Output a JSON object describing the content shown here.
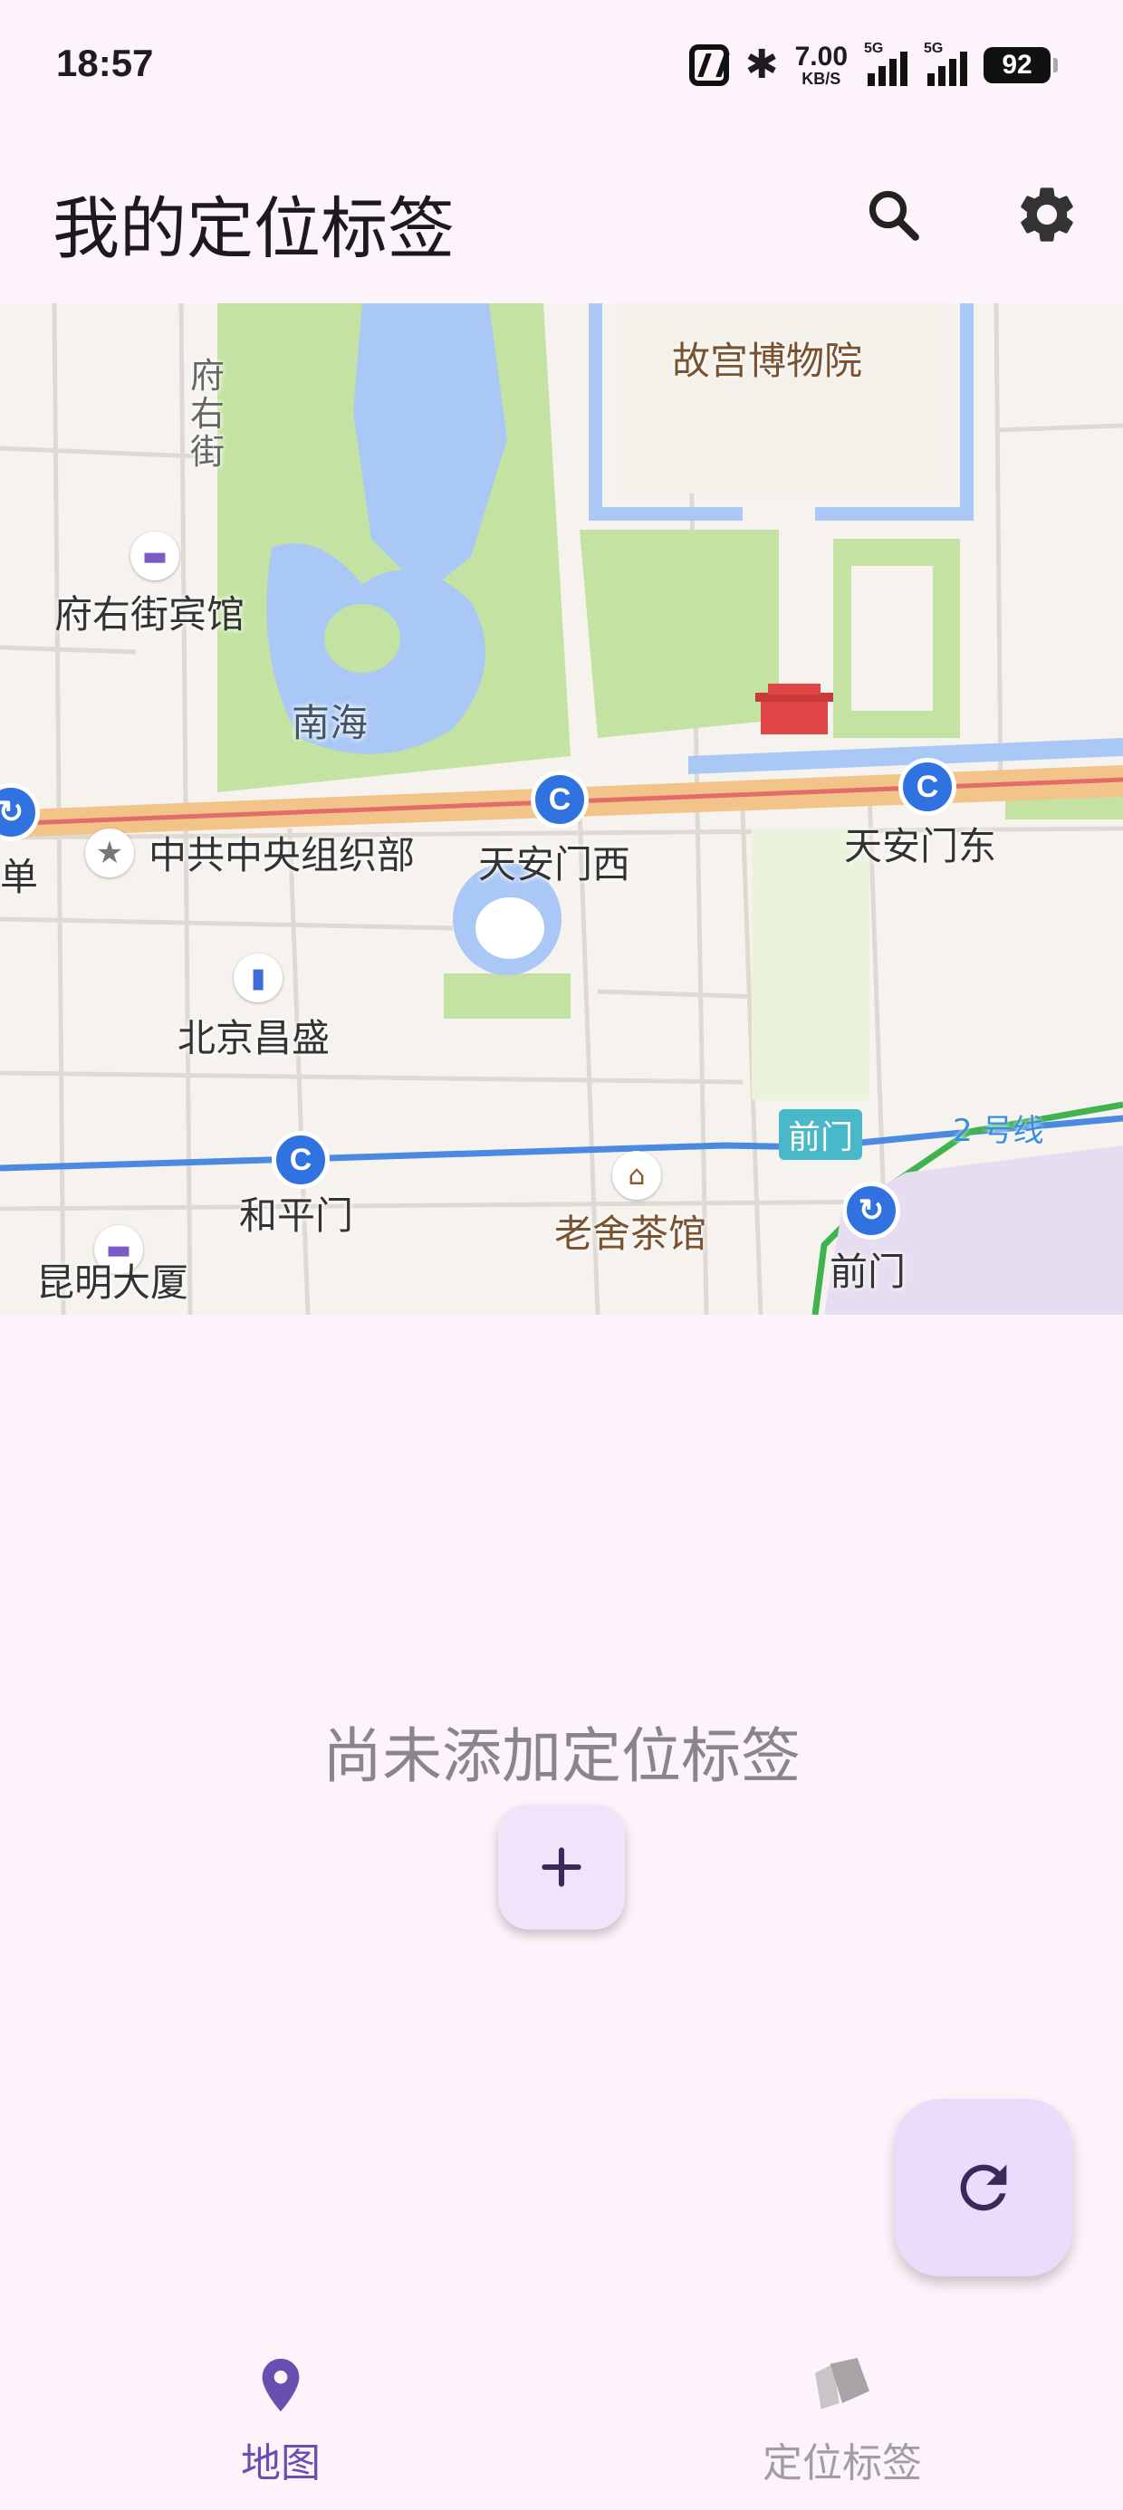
{
  "status_bar": {
    "time": "18:57",
    "net_speed_value": "7.00",
    "net_speed_unit": "KB/S",
    "signal1_label": "5G",
    "signal2_label": "5G",
    "battery": "92"
  },
  "app_bar": {
    "title": "我的定位标签",
    "icons": [
      "search-icon",
      "settings-icon"
    ]
  },
  "map": {
    "labels": {
      "palace_museum": "故宫博物院",
      "fuyoujie_vertical": "府右街",
      "fuyoujie_hotel": "府右街宾馆",
      "nanhai": "南海",
      "xidan_partial": "单",
      "org_dept": "中共中央组织部",
      "tiananmen_west": "天安门西",
      "tiananmen_east": "天安门东",
      "beijing_changsheng": "北京昌盛",
      "hepingmen": "和平门",
      "laoshe_teahouse": "老舍茶馆",
      "qianmen_tag": "前门",
      "qianmen_station": "前门",
      "line2": "2 号线",
      "kunming_building": "昆明大厦"
    },
    "colors": {
      "water": "#a9c8f5",
      "park": "#c4e3a2",
      "road_main": "#f2c48a",
      "metro_line": "#4a8ae0",
      "metro_station": "#2f72e0",
      "palace_wall": "#a9c8f5"
    }
  },
  "empty_state": {
    "text": "尚未添加定位标签",
    "add_icon": "plus-icon"
  },
  "fab": {
    "icon": "refresh-icon"
  },
  "bottom_nav": {
    "items": [
      {
        "label": "地图",
        "icon": "map-pin-icon",
        "selected": true
      },
      {
        "label": "定位标签",
        "icon": "tags-icon",
        "selected": false
      }
    ],
    "accent": "#6a4fb0"
  }
}
